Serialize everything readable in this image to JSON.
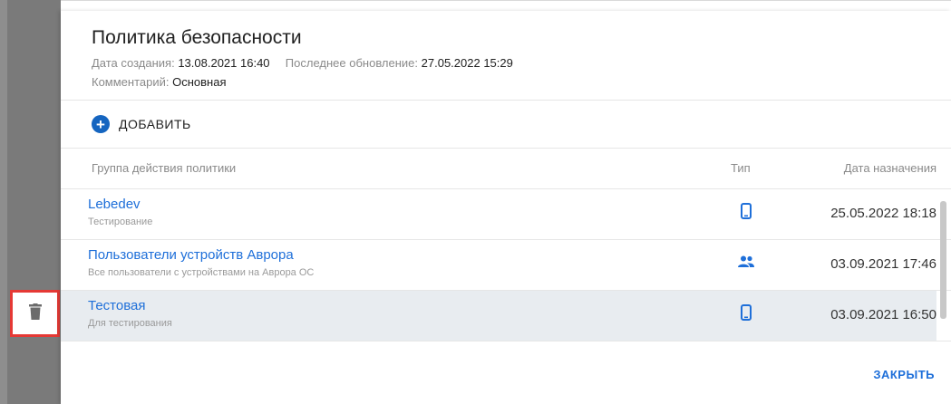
{
  "dialog": {
    "title": "Политика безопасности",
    "created_label": "Дата создания: ",
    "created_value": "13.08.2021 16:40",
    "updated_label": "Последнее обновление: ",
    "updated_value": "27.05.2022 15:29",
    "comment_label": "Комментарий: ",
    "comment_value": "Основная",
    "add_label": "ДОБАВИТЬ",
    "close_label": "ЗАКРЫТЬ"
  },
  "table": {
    "columns": [
      "Группа действия политики",
      "Тип",
      "Дата назначения"
    ],
    "rows": [
      {
        "name": "Lebedev",
        "desc": "Тестирование",
        "type_icon": "phone-icon",
        "date": "25.05.2022 18:18"
      },
      {
        "name": "Пользователи устройств Аврора",
        "desc": "Все пользователи с устройствами на Аврора ОС",
        "type_icon": "group-icon",
        "date": "03.09.2021 17:46"
      },
      {
        "name": "Тестовая",
        "desc": "Для тестирования",
        "type_icon": "phone-icon",
        "date": "03.09.2021 16:50"
      }
    ]
  },
  "side": {
    "delete_icon": "trash-icon"
  },
  "colors": {
    "accent": "#1e6fd9",
    "highlight_border": "#e53935",
    "selected_row": "#e8ecf0"
  }
}
